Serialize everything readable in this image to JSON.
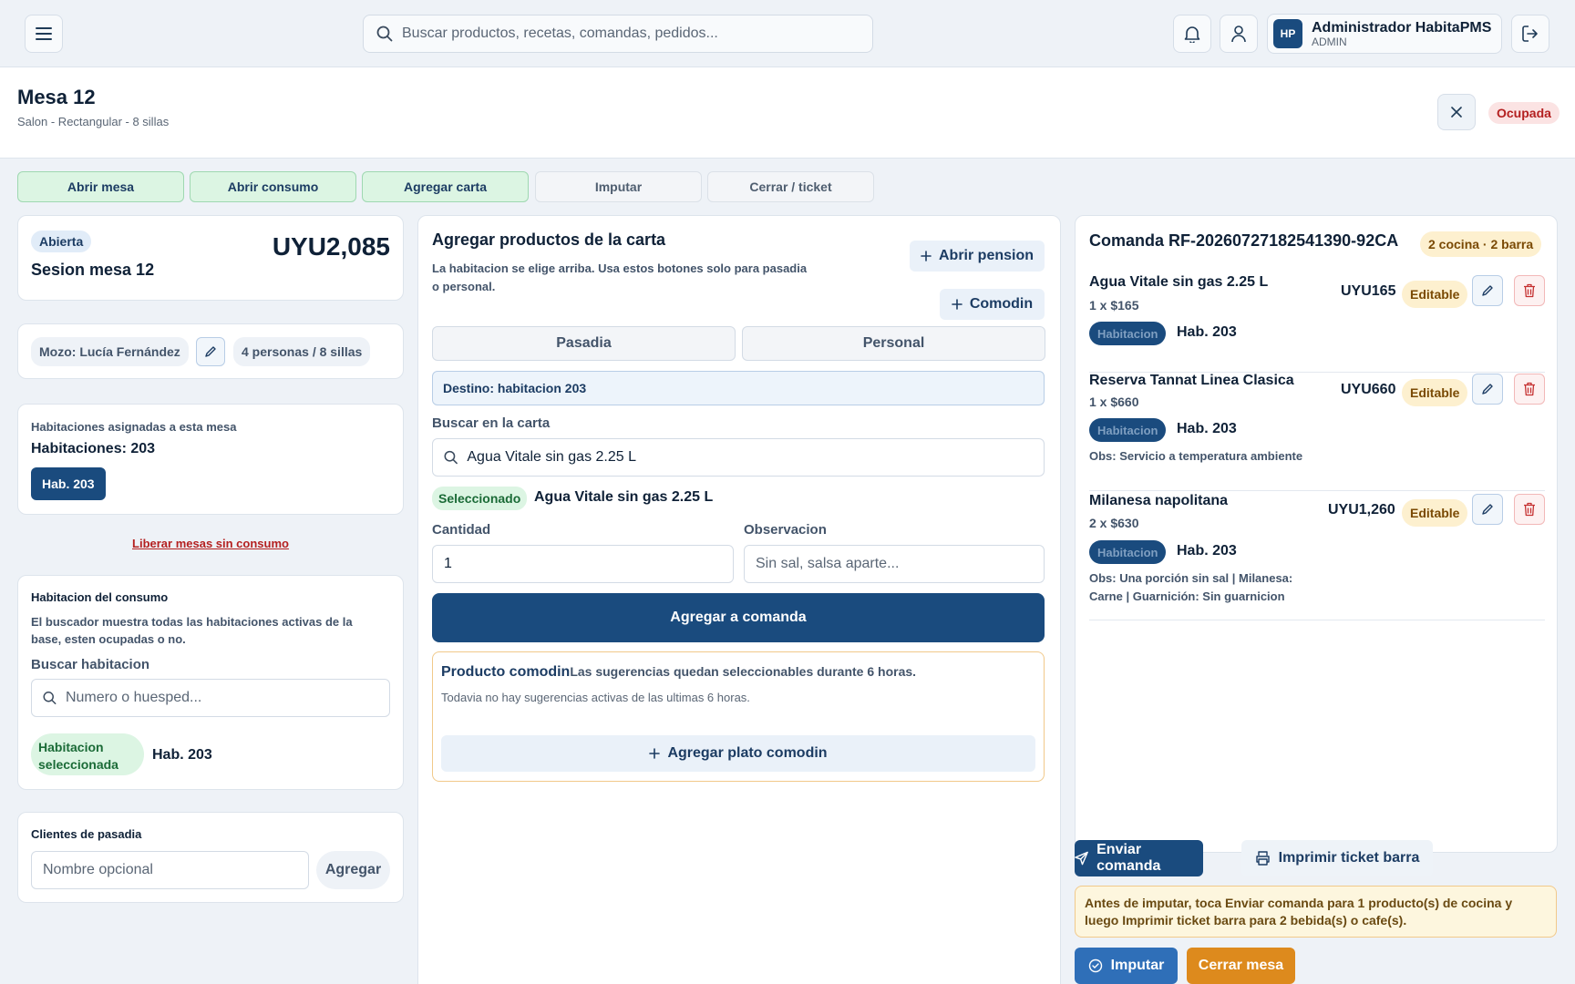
{
  "topbar": {
    "search_placeholder": "Buscar productos, recetas, comandas, pedidos...",
    "avatar_initials": "HP",
    "user_name": "Administrador HabitaPMS",
    "user_role": "ADMIN",
    "icons": [
      "menu-icon",
      "search-icon",
      "bell-icon",
      "user-icon",
      "logout-icon"
    ]
  },
  "mesa": {
    "title": "Mesa 12",
    "subtitle": "Salon - Rectangular - 8 sillas",
    "status": "Ocupada",
    "status_color": "#b42020"
  },
  "actions": [
    {
      "label": "Abrir mesa",
      "active": true
    },
    {
      "label": "Abrir consumo",
      "active": true
    },
    {
      "label": "Agregar carta",
      "active": true
    },
    {
      "label": "Imputar",
      "active": false
    },
    {
      "label": "Cerrar / ticket",
      "active": false
    }
  ],
  "session": {
    "state": "Abierta",
    "name": "Sesion mesa 12",
    "total": "UYU2,085"
  },
  "waiter": {
    "mozo": "Mozo: Lucía Fernández",
    "people": "4 personas / 8 sillas"
  },
  "rooms": {
    "heading": "Habitaciones asignadas a esta mesa",
    "summary": "Habitaciones: 203",
    "chip": "Hab. 203",
    "release_link": "Liberar mesas sin consumo"
  },
  "room_consumo": {
    "heading": "Habitacion del consumo",
    "help": "El buscador muestra todas las habitaciones activas de la base, esten ocupadas o no.",
    "search_label": "Buscar habitacion",
    "search_placeholder": "Numero o huesped...",
    "selected_badge": "Habitacion seleccionada",
    "selected_room": "Hab. 203"
  },
  "pasadia": {
    "heading": "Clientes de pasadia",
    "name_placeholder": "Nombre opcional",
    "add_label": "Agregar"
  },
  "carta": {
    "title": "Agregar productos de la carta",
    "description": "La habitacion se elige arriba. Usa estos botones solo para pasadia o personal.",
    "open_pension": "Abrir pension",
    "comodin": "Comodin",
    "segments": [
      "Pasadia",
      "Personal"
    ],
    "destino": "Destino: habitacion 203",
    "search_label": "Buscar en la carta",
    "search_value": "Agua Vitale sin gas 2.25 L",
    "selected_badge": "Seleccionado",
    "selected_product": "Agua Vitale sin gas 2.25 L",
    "qty_label": "Cantidad",
    "qty_value": "1",
    "obs_label": "Observacion",
    "obs_placeholder": "Sin sal, salsa aparte...",
    "add_button": "Agregar a comanda",
    "comodin_title": "Producto comodin",
    "comodin_note": "Las sugerencias quedan seleccionables durante 6 horas.",
    "comodin_empty": "Todavia no hay sugerencias activas de las ultimas 6 horas.",
    "comodin_add": "Agregar plato comodin"
  },
  "comanda": {
    "title": "Comanda RF-20260727182541390-92CA",
    "badge": "2 cocina · 2 barra",
    "items": [
      {
        "name": "Agua Vitale sin gas 2.25 L",
        "qty": "1 x $165",
        "price": "UYU165",
        "status": "Editable",
        "tag": "Habitacion",
        "room": "Hab. 203",
        "obs": ""
      },
      {
        "name": "Reserva Tannat Linea Clasica",
        "qty": "1 x $660",
        "price": "UYU660",
        "status": "Editable",
        "tag": "Habitacion",
        "room": "Hab. 203",
        "obs": "Obs: Servicio a temperatura ambiente"
      },
      {
        "name": "Milanesa napolitana",
        "qty": "2 x $630",
        "price": "UYU1,260",
        "status": "Editable",
        "tag": "Habitacion",
        "room": "Hab. 203",
        "obs": "Obs: Una porción sin sal | Milanesa: Carne | Guarnición: Sin guarnicion"
      }
    ],
    "send_button": "Enviar comanda",
    "print_button": "Imprimir ticket barra",
    "warning": "Antes de imputar, toca Enviar comanda para 1 producto(s) de cocina y luego Imprimir ticket barra para 2 bebida(s) o cafe(s).",
    "impute_button": "Imputar",
    "close_button": "Cerrar mesa"
  },
  "colors": {
    "primary": "#1a4b7e",
    "accent_orange": "#dd8a1d",
    "success_bg": "#dcf5e3",
    "warning_bg": "#fdf6de"
  }
}
